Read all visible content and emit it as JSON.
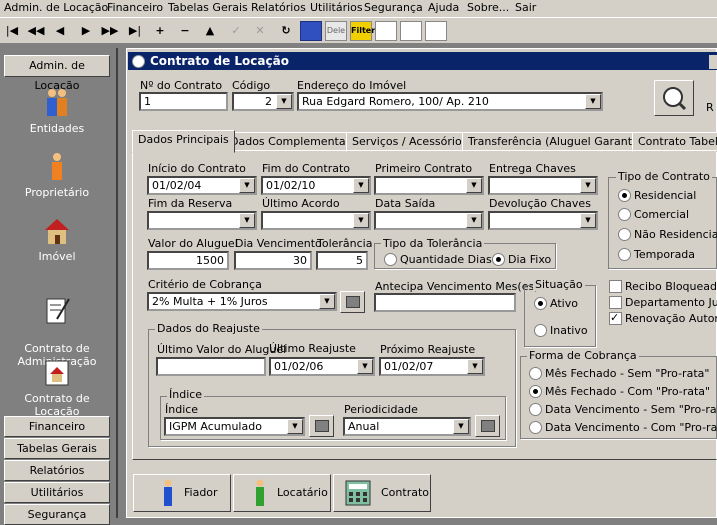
{
  "menu": [
    "Admin. de Locação",
    "Financeiro",
    "Tabelas Gerais",
    "Relatórios",
    "Utilitários",
    "Segurança",
    "Ajuda",
    "Sobre...",
    "Sair"
  ],
  "toolbar": {
    "nav": [
      "|◀",
      "◀◀",
      "◀",
      "▶",
      "▶▶",
      "▶|",
      "+",
      "−",
      "▲",
      "✓",
      "✕",
      "↻"
    ],
    "icons": [
      "edit-icon",
      "erase-icon",
      "filter-icon",
      "report-icon",
      "print-icon",
      "exit-icon"
    ],
    "filter_label": "Filter",
    "erase_label": "Dele"
  },
  "sidebar": {
    "header": "Admin. de Locação",
    "items": [
      "Entidades",
      "Proprietário",
      "Imóvel",
      "Contrato de\nAdministração",
      "Contrato de Locação"
    ],
    "buttons": [
      "Financeiro",
      "Tabelas Gerais",
      "Relatórios",
      "Utilitários",
      "Segurança"
    ]
  },
  "window": {
    "title": "Contrato de Locação",
    "side_button_fragment": "R",
    "header_fields": {
      "contrato_label": "Nº do Contrato",
      "contrato_value": "1",
      "codigo_label": "Código",
      "codigo_value": "2",
      "endereco_label": "Endereço do Imóvel",
      "endereco_value": "Rua Edgard Romero, 100/ Ap. 210"
    },
    "tabs": [
      "Dados Principais",
      "Dados Complementares",
      "Serviços / Acessórios",
      "Transferência (Aluguel Garantido)",
      "Contrato Tabela"
    ],
    "form": {
      "inicio_label": "Início do Contrato",
      "inicio_value": "01/02/04",
      "fim_label": "Fim do Contrato",
      "fim_value": "01/02/10",
      "primeiro_label": "Primeiro Contrato",
      "primeiro_value": "",
      "entrega_label": "Entrega Chaves",
      "entrega_value": "",
      "fimreserva_label": "Fim da Reserva",
      "fimreserva_value": "",
      "ultimoacordo_label": "Último Acordo",
      "ultimoacordo_value": "",
      "datasaida_label": "Data Saída",
      "datasaida_value": "",
      "devolucao_label": "Devolução Chaves",
      "devolucao_value": "",
      "valor_label": "Valor do Aluguel",
      "valor_value": "1500",
      "diavenc_label": "Dia Vencimento",
      "diavenc_value": "30",
      "tolerancia_label": "Tolerância",
      "tolerancia_value": "5",
      "tipotol_label": "Tipo da Tolerância",
      "tipotol_options": [
        "Quantidade Dias",
        "Dia Fixo"
      ],
      "criterio_label": "Critério de Cobrança",
      "criterio_value": "2% Multa + 1% Juros",
      "antecipa_label": "Antecipa Vencimento Mes(es)",
      "antecipa_value": "",
      "situacao_label": "Situação",
      "situacao_options": [
        "Ativo",
        "Inativo"
      ],
      "reajuste_label": "Dados do Reajuste",
      "ultimovalor_label": "Último Valor do Aluguel",
      "ultimovalor_value": "",
      "ultimoreaj_label": "Último Reajuste",
      "ultimoreaj_value": "01/02/06",
      "proximoreaj_label": "Próximo Reajuste",
      "proximoreaj_value": "01/02/07",
      "indice_group_label": "Índice",
      "indice_label": "Índice",
      "indice_value": "IGPM  Acumulado",
      "periodicidade_label": "Periodicidade",
      "periodicidade_value": "Anual",
      "tipocontrato_label": "Tipo de Contrato",
      "tipocontrato_options": [
        "Residencial",
        "Comercial",
        "Não Residencial",
        "Temporada"
      ],
      "checks": [
        "Recibo Bloqueado",
        "Departamento Juríd",
        "Renovação Automá"
      ],
      "forma_label": "Forma de Cobrança",
      "forma_options": [
        "Mês Fechado - Sem \"Pro-rata\"",
        "Mês Fechado - Com \"Pro-rata\"",
        "Data Vencimento - Sem \"Pro-rata\"",
        "Data Vencimento - Com \"Pro-rata\""
      ]
    },
    "bottom_buttons": [
      "Fiador",
      "Locatário",
      "Contrato"
    ]
  }
}
